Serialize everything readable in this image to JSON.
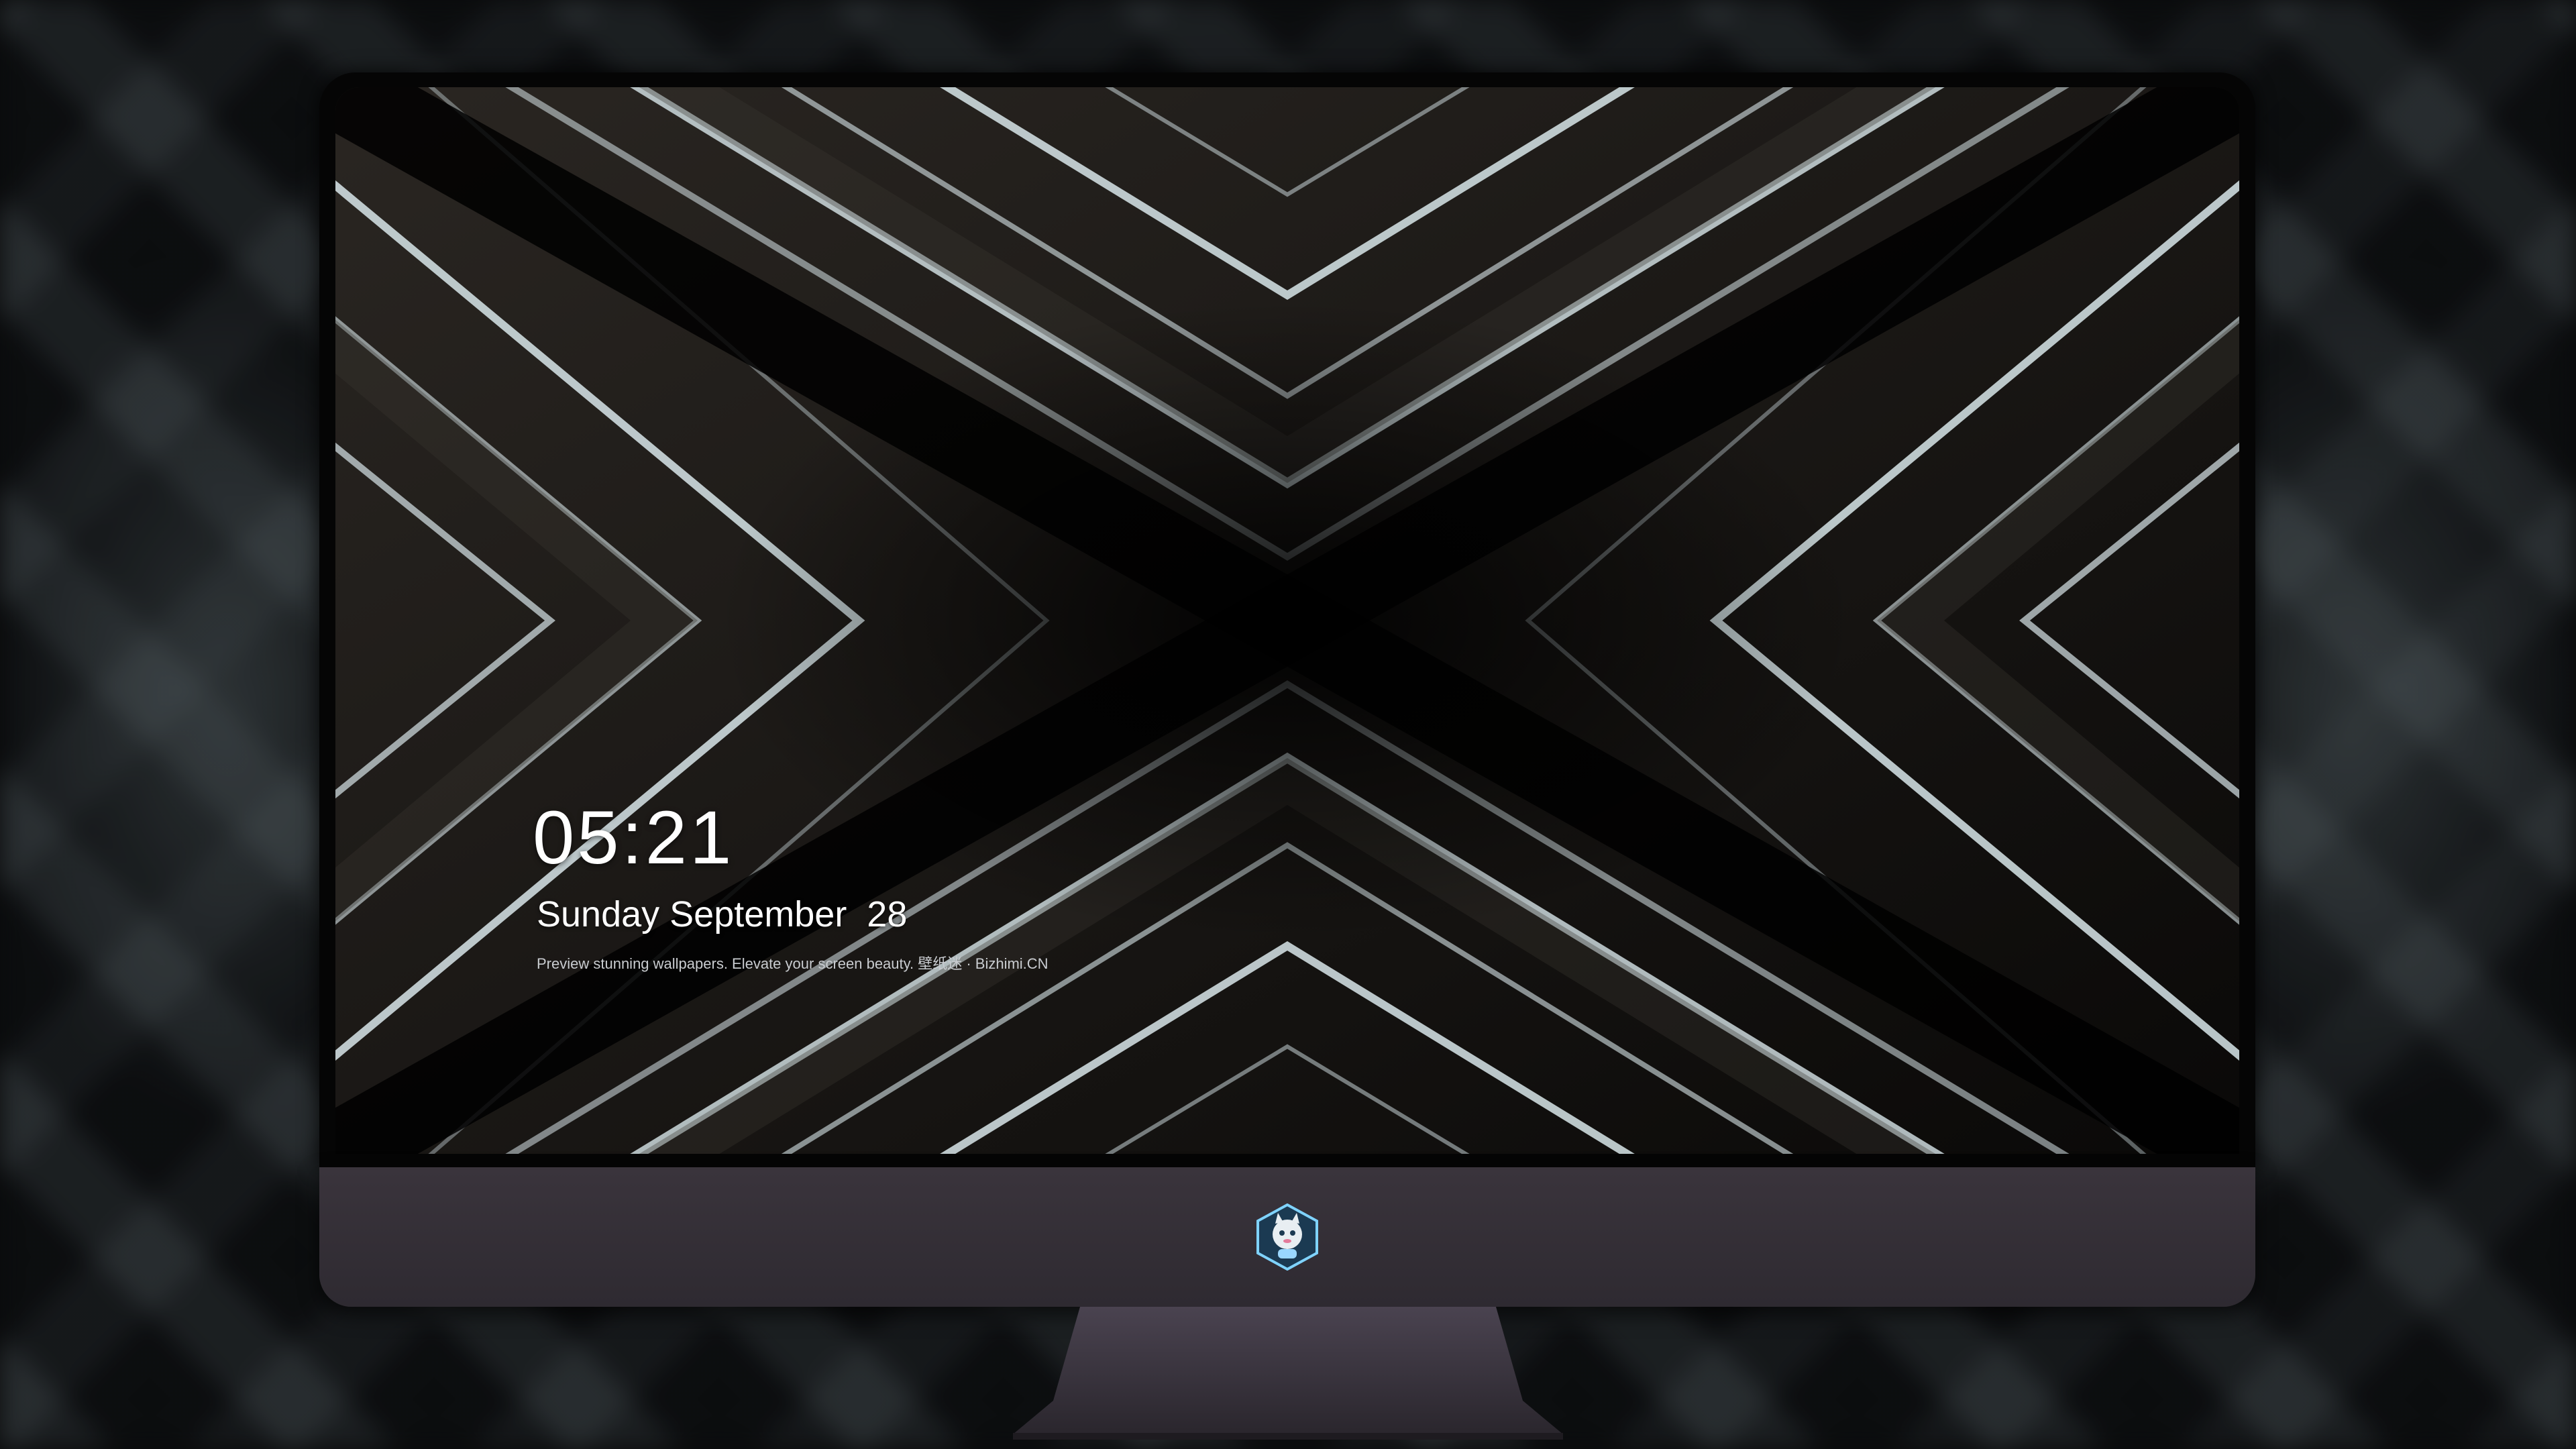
{
  "lock_screen": {
    "time": "05:21",
    "date": "Sunday September  28",
    "tagline": "Preview stunning wallpapers. Elevate your screen beauty. 壁纸迷 · Bizhimi.CN"
  },
  "dock": {
    "apps": [
      {
        "name": "messages-icon",
        "color": "#34c759"
      },
      {
        "name": "weather-icon",
        "color": "#1e88e5"
      },
      {
        "name": "clock-icon",
        "color": "#f2f2f2"
      },
      {
        "name": "preview-icon",
        "color": "#4aa3df"
      },
      {
        "name": "claquette-icon",
        "color": "#3cc8d8"
      },
      {
        "name": "notes-icon",
        "color": "#ffcc00"
      },
      {
        "name": "photo-collage-icon",
        "color": "#ffffff"
      },
      {
        "name": "music-icon",
        "color": "#e040fb"
      },
      {
        "name": "app-store-icon",
        "color": "#1e88e5"
      },
      {
        "name": "camera-icon",
        "color": "#8e8e93"
      }
    ]
  },
  "colors": {
    "chin": "#35303a",
    "wallpaper_highlight": "#e8f2f5"
  }
}
